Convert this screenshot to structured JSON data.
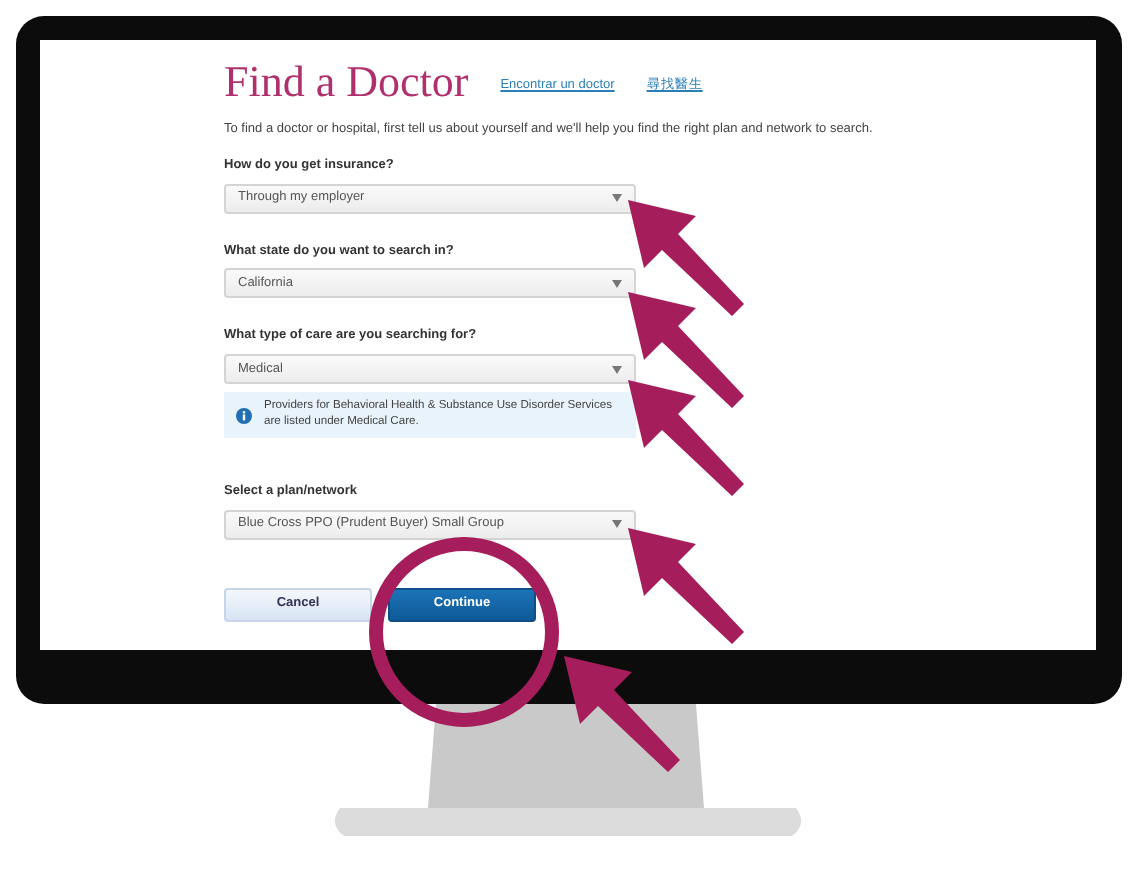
{
  "page": {
    "title": "Find a Doctor",
    "language_links": [
      "Encontrar un doctor",
      "尋找醫生"
    ],
    "intro": "To find a doctor or hospital, first tell us about yourself and we'll help you find the right plan and network to search.",
    "fields": [
      {
        "label": "How do you get insurance?",
        "value": "Through my employer"
      },
      {
        "label": "What state do you want to search in?",
        "value": "California"
      },
      {
        "label": "What type of care are you searching for?",
        "value": "Medical",
        "note": "Providers for Behavioral Health & Substance Use Disorder Services are listed under Medical Care."
      },
      {
        "label": "Select a plan/network",
        "value": "Blue Cross PPO (Prudent Buyer) Small Group"
      }
    ],
    "buttons": [
      {
        "label": "Cancel",
        "kind": "secondary"
      },
      {
        "label": "Continue",
        "kind": "primary"
      }
    ]
  }
}
